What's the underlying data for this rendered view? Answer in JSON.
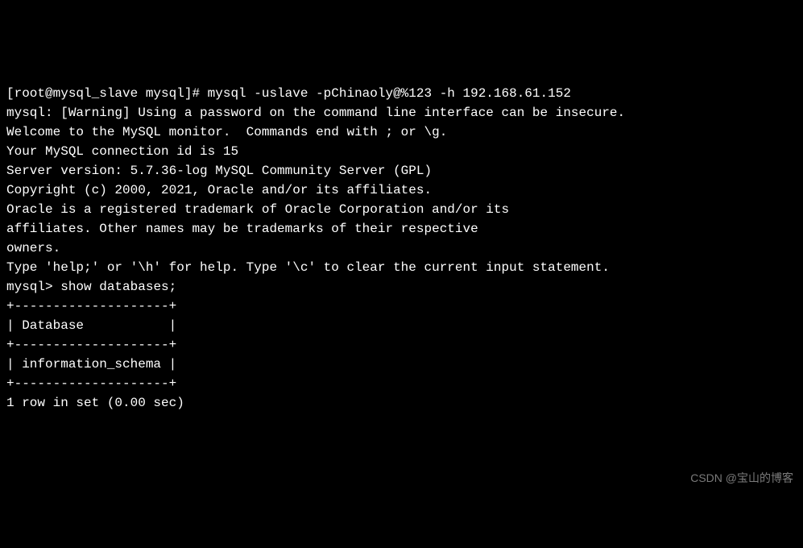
{
  "terminal": {
    "prompt1": "[root@mysql_slave mysql]# ",
    "command1": "mysql -uslave -pChinaoly@%123 -h 192.168.61.152",
    "warning": "mysql: [Warning] Using a password on the command line interface can be insecure.",
    "welcome": "Welcome to the MySQL monitor.  Commands end with ; or \\g.",
    "connection_id": "Your MySQL connection id is 15",
    "server_version": "Server version: 5.7.36-log MySQL Community Server (GPL)",
    "blank1": "",
    "copyright": "Copyright (c) 2000, 2021, Oracle and/or its affiliates.",
    "blank2": "",
    "trademark1": "Oracle is a registered trademark of Oracle Corporation and/or its",
    "trademark2": "affiliates. Other names may be trademarks of their respective",
    "trademark3": "owners.",
    "blank3": "",
    "help": "Type 'help;' or '\\h' for help. Type '\\c' to clear the current input statement.",
    "blank4": "",
    "prompt2": "mysql> ",
    "command2": "show databases;",
    "table_border": "+--------------------+",
    "table_header": "| Database           |",
    "table_row": "| information_schema |",
    "result_summary": "1 row in set (0.00 sec)"
  },
  "watermark": "CSDN @宝山的博客"
}
